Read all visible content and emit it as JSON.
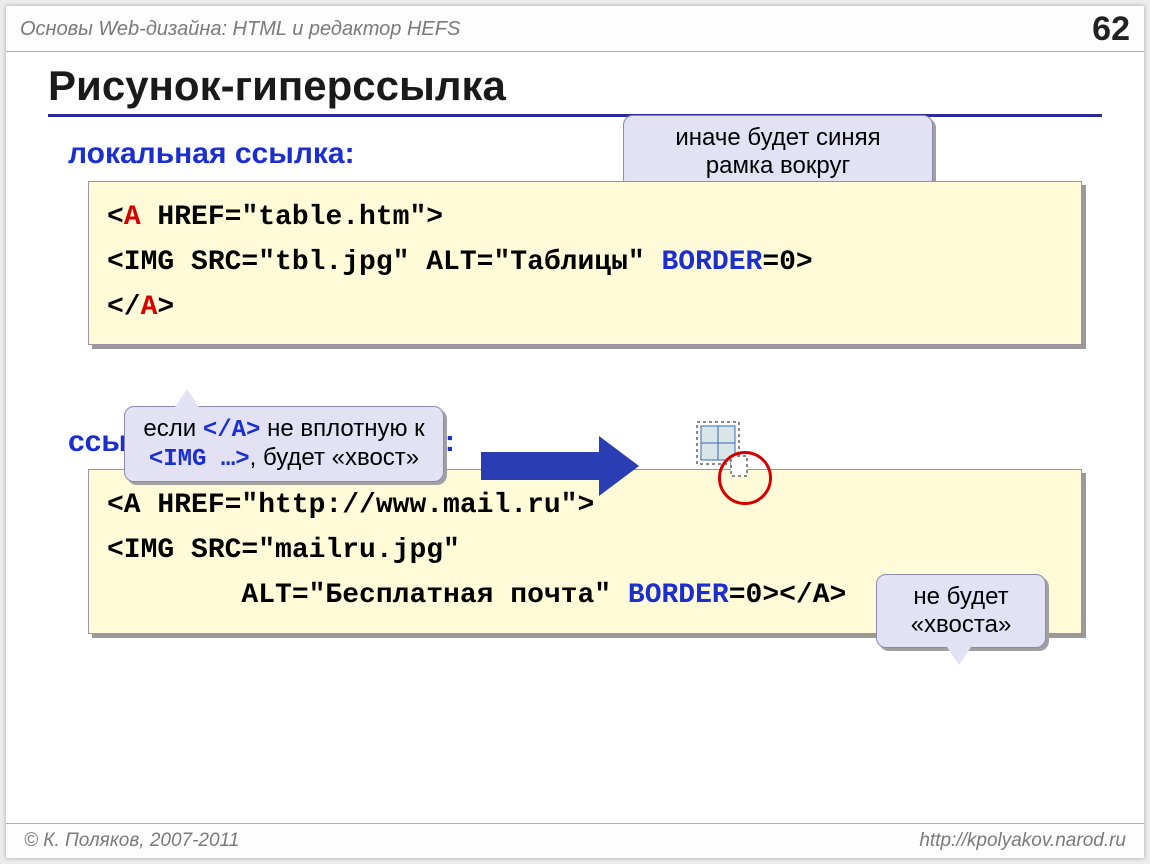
{
  "header": {
    "title": "Основы Web-дизайна: HTML и редактор HEFS",
    "page": "62"
  },
  "title": "Рисунок-гиперссылка",
  "section1": {
    "label": "локальная ссылка:"
  },
  "callout1": {
    "line1": "иначе будет синяя",
    "line2": "рамка вокруг"
  },
  "code1": {
    "t1": "<",
    "tag_a_open": "A",
    "t2": " HREF=\"table.htm\">",
    "line2a": "<IMG SRC=\"tbl.jpg\" ALT=\"Таблицы\" ",
    "border_kw": "BORDER",
    "line2b": "=0>",
    "t3": "</",
    "tag_a_close": "A",
    "t4": ">"
  },
  "callout2": {
    "p1": "если ",
    "c1": "</A>",
    "p2": " не вплотную к",
    "c2": "<IMG …>",
    "p3": ", будет «хвост»"
  },
  "section2": {
    "label": "ссылка на другой сервер:"
  },
  "callout3": {
    "line1": "не будет",
    "line2": "«хвоста»"
  },
  "code2": {
    "line1": "<A HREF=\"http://www.mail.ru\">",
    "line2": "<IMG SRC=\"mailru.jpg\"",
    "line3a": "        ALT=\"Бесплатная почта\" ",
    "border_kw": "BORDER",
    "line3b": "=0></A>"
  },
  "footer": {
    "left": "© К. Поляков, 2007-2011",
    "right": "http://kpolyakov.narod.ru"
  }
}
